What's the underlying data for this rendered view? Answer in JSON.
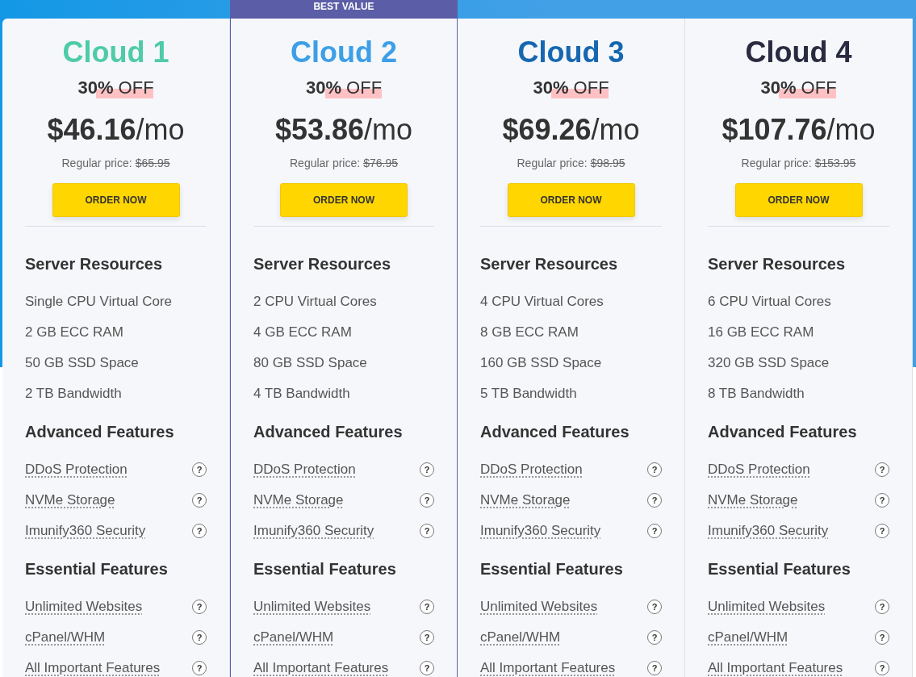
{
  "plans": [
    {
      "name": "Cloud 1",
      "color": "#4ecba8",
      "highlighted": false,
      "discount": "**30%** OFF",
      "price": "**$46.16**/mo",
      "regular_price_label": "Regular price:",
      "regular_price": "$65.95",
      "order_button": "ORDER NOW",
      "sections": [
        {
          "title": "Server Resources",
          "kind": "plain",
          "items": [
            {
              "label": "Single CPU Virtual Core"
            },
            {
              "label": "2 GB ECC RAM"
            },
            {
              "label": "50 GB SSD Space"
            },
            {
              "label": "2 TB Bandwidth"
            }
          ]
        },
        {
          "title": "Advanced Features",
          "kind": "tooltip",
          "items": [
            {
              "label": "DDoS Protection",
              "hint_icon": "?"
            },
            {
              "label": "NVMe Storage",
              "hint_icon": "?"
            },
            {
              "label": "Imunify360 Security",
              "hint_icon": "?"
            }
          ]
        },
        {
          "title": "Essential Features",
          "kind": "tooltip",
          "items": [
            {
              "label": "Unlimited Websites",
              "hint_icon": "?"
            },
            {
              "label": "cPanel/WHM",
              "hint_icon": "?"
            },
            {
              "label": "All Important Features",
              "hint_icon": "?"
            }
          ]
        }
      ]
    },
    {
      "name": "Cloud 2",
      "color": "#3d9fe6",
      "highlighted": true,
      "badge": "BEST VALUE",
      "discount": "**30%** OFF",
      "price": "**$53.86**/mo",
      "regular_price_label": "Regular price:",
      "regular_price": "$76.95",
      "order_button": "ORDER NOW",
      "sections": [
        {
          "title": "Server Resources",
          "kind": "plain",
          "items": [
            {
              "label": "2 CPU Virtual Cores"
            },
            {
              "label": "4 GB ECC RAM"
            },
            {
              "label": "80 GB SSD Space"
            },
            {
              "label": "4 TB Bandwidth"
            }
          ]
        },
        {
          "title": "Advanced Features",
          "kind": "tooltip",
          "items": [
            {
              "label": "DDoS Protection",
              "hint_icon": "?"
            },
            {
              "label": "NVMe Storage",
              "hint_icon": "?"
            },
            {
              "label": "Imunify360 Security",
              "hint_icon": "?"
            }
          ]
        },
        {
          "title": "Essential Features",
          "kind": "tooltip",
          "items": [
            {
              "label": "Unlimited Websites",
              "hint_icon": "?"
            },
            {
              "label": "cPanel/WHM",
              "hint_icon": "?"
            },
            {
              "label": "All Important Features",
              "hint_icon": "?"
            }
          ]
        }
      ]
    },
    {
      "name": "Cloud 3",
      "color": "#1667b0",
      "highlighted": false,
      "discount": "**30%** OFF",
      "price": "**$69.26**/mo",
      "regular_price_label": "Regular price:",
      "regular_price": "$98.95",
      "order_button": "ORDER NOW",
      "sections": [
        {
          "title": "Server Resources",
          "kind": "plain",
          "items": [
            {
              "label": "4 CPU Virtual Cores"
            },
            {
              "label": "8 GB ECC RAM"
            },
            {
              "label": "160 GB SSD Space"
            },
            {
              "label": "5 TB Bandwidth"
            }
          ]
        },
        {
          "title": "Advanced Features",
          "kind": "tooltip",
          "items": [
            {
              "label": "DDoS Protection",
              "hint_icon": "?"
            },
            {
              "label": "NVMe Storage",
              "hint_icon": "?"
            },
            {
              "label": "Imunify360 Security",
              "hint_icon": "?"
            }
          ]
        },
        {
          "title": "Essential Features",
          "kind": "tooltip",
          "items": [
            {
              "label": "Unlimited Websites",
              "hint_icon": "?"
            },
            {
              "label": "cPanel/WHM",
              "hint_icon": "?"
            },
            {
              "label": "All Important Features",
              "hint_icon": "?"
            }
          ]
        }
      ]
    },
    {
      "name": "Cloud 4",
      "color": "#2a2a40",
      "highlighted": false,
      "discount": "**30%** OFF",
      "price": "**$107.76**/mo",
      "regular_price_label": "Regular price:",
      "regular_price": "$153.95",
      "order_button": "ORDER NOW",
      "sections": [
        {
          "title": "Server Resources",
          "kind": "plain",
          "items": [
            {
              "label": "6 CPU Virtual Cores"
            },
            {
              "label": "16 GB ECC RAM"
            },
            {
              "label": "320 GB SSD Space"
            },
            {
              "label": "8 TB Bandwidth"
            }
          ]
        },
        {
          "title": "Advanced Features",
          "kind": "tooltip",
          "items": [
            {
              "label": "DDoS Protection",
              "hint_icon": "?"
            },
            {
              "label": "NVMe Storage",
              "hint_icon": "?"
            },
            {
              "label": "Imunify360 Security",
              "hint_icon": "?"
            }
          ]
        },
        {
          "title": "Essential Features",
          "kind": "tooltip",
          "items": [
            {
              "label": "Unlimited Websites",
              "hint_icon": "?"
            },
            {
              "label": "cPanel/WHM",
              "hint_icon": "?"
            },
            {
              "label": "All Important Features",
              "hint_icon": "?"
            }
          ]
        }
      ]
    }
  ]
}
